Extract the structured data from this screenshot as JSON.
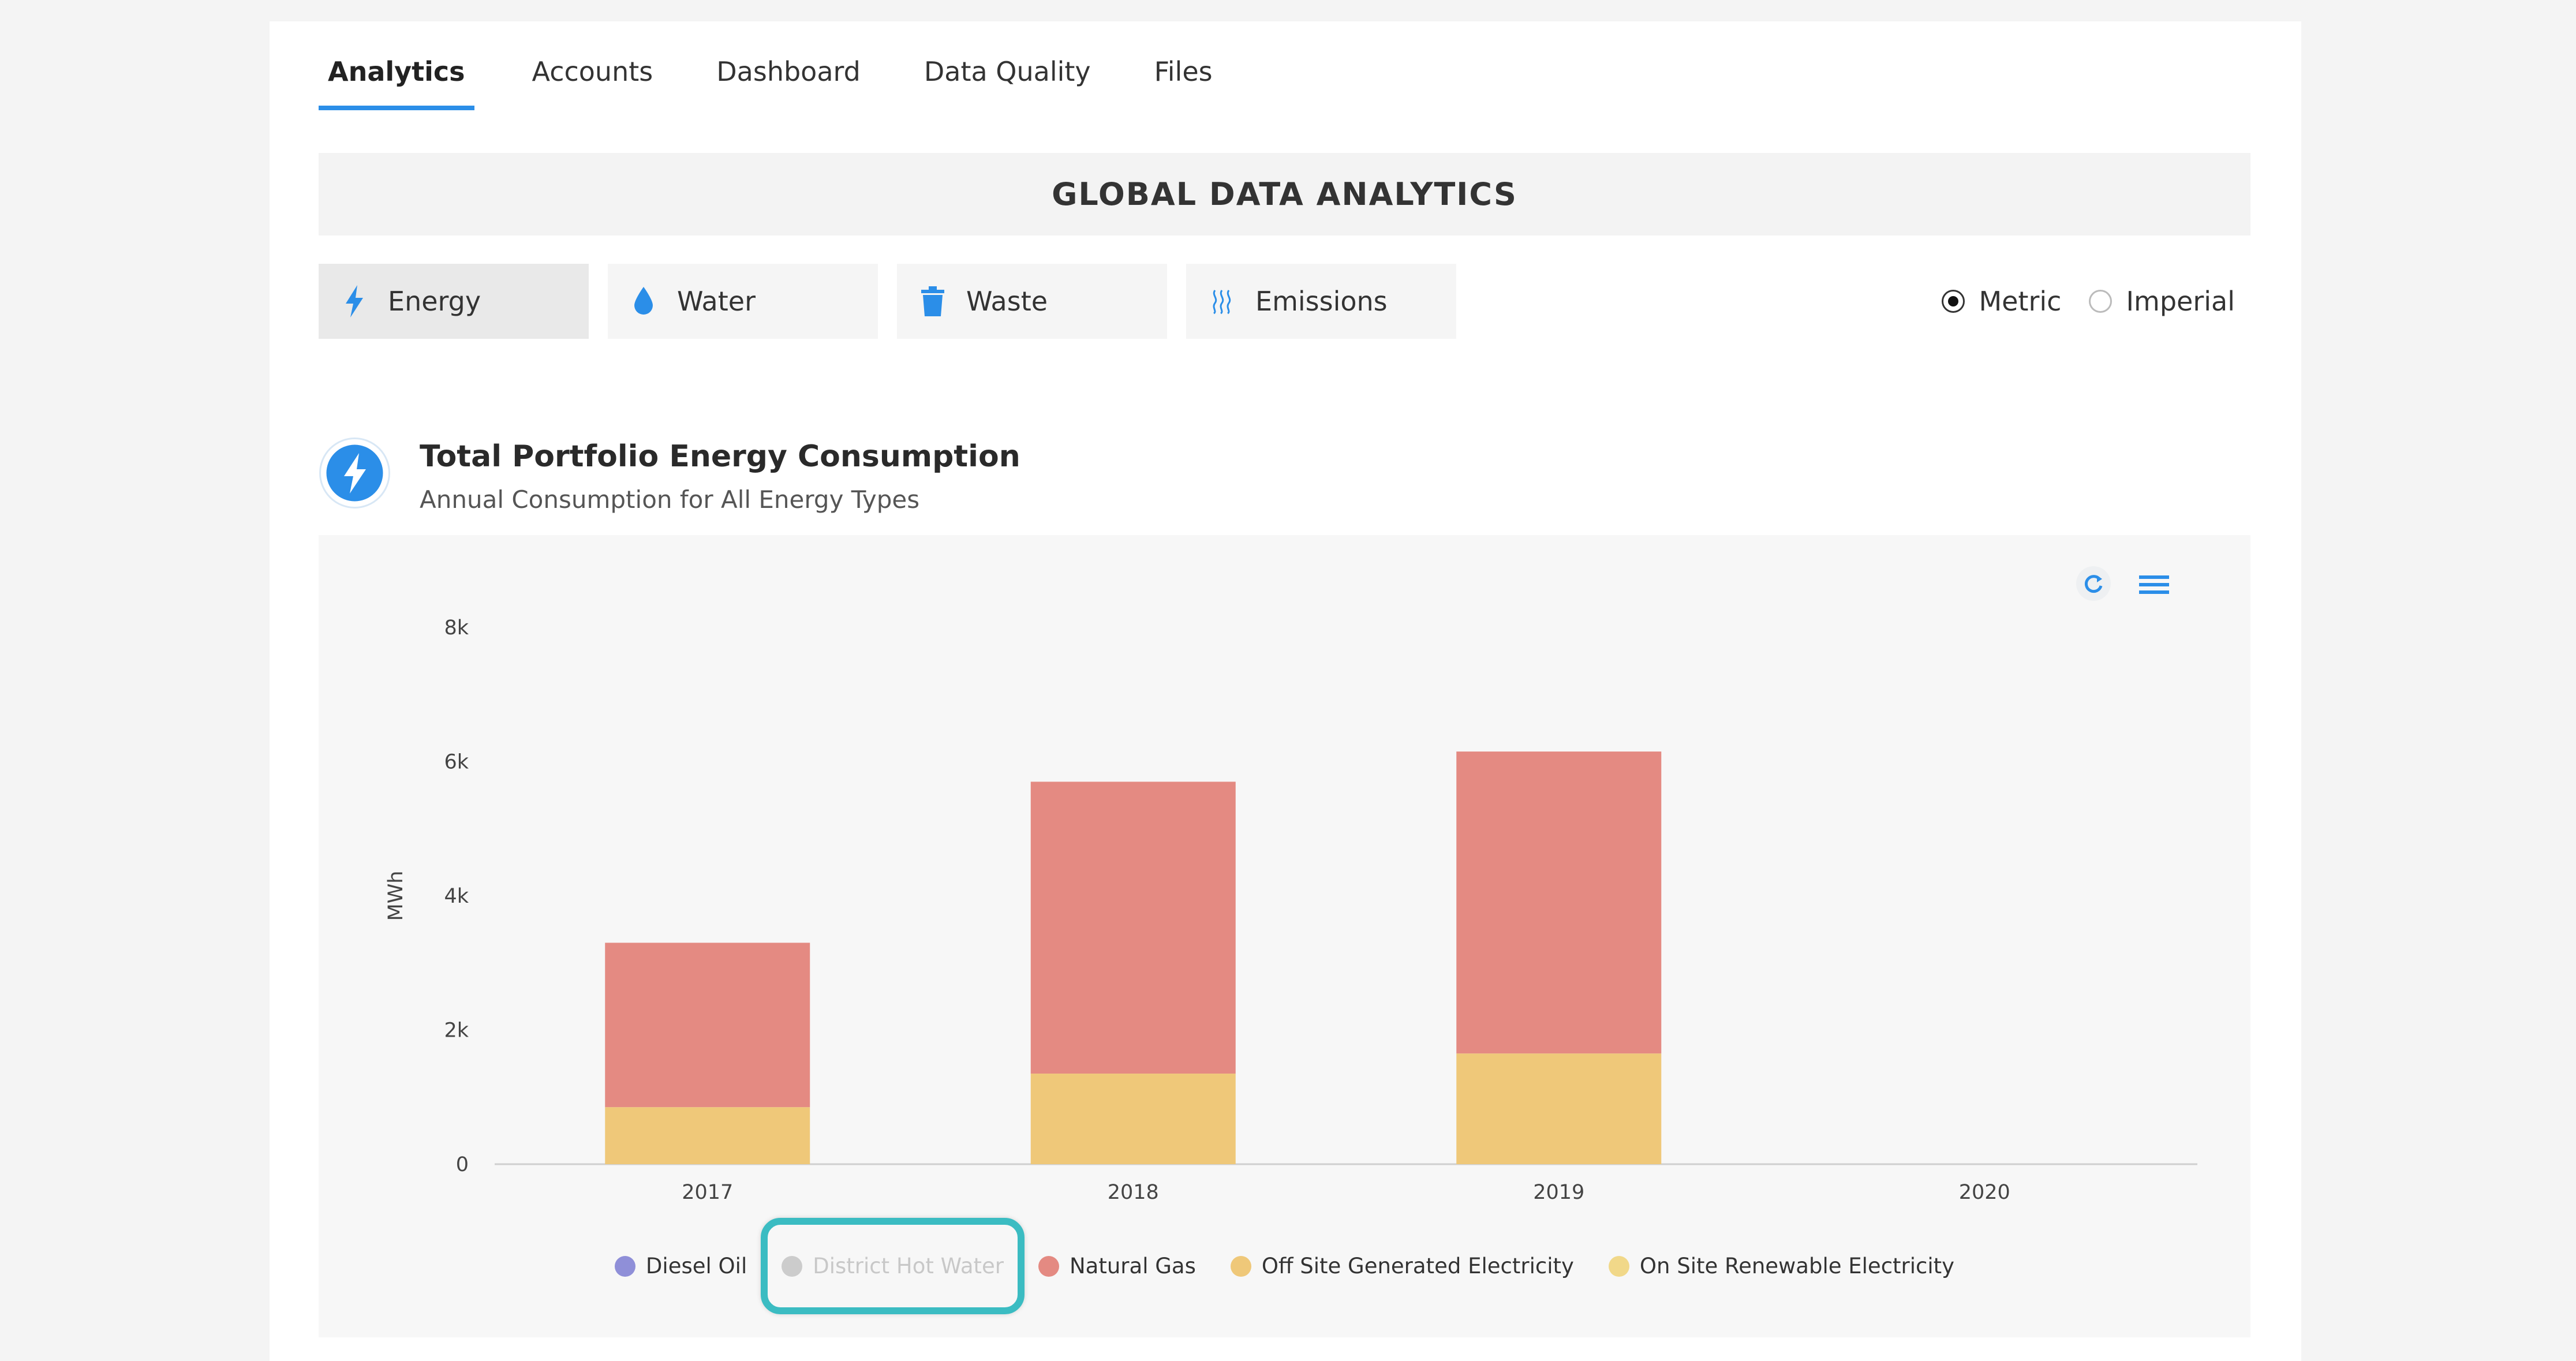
{
  "tabs": [
    {
      "label": "Analytics",
      "active": true
    },
    {
      "label": "Accounts"
    },
    {
      "label": "Dashboard"
    },
    {
      "label": "Data Quality"
    },
    {
      "label": "Files"
    }
  ],
  "banner_title": "GLOBAL DATA ANALYTICS",
  "categories": [
    {
      "label": "Energy",
      "icon": "lightning-icon",
      "active": true
    },
    {
      "label": "Water",
      "icon": "water-drop-icon"
    },
    {
      "label": "Waste",
      "icon": "trash-icon"
    },
    {
      "label": "Emissions",
      "icon": "heat-waves-icon"
    }
  ],
  "units": {
    "metric": "Metric",
    "imperial": "Imperial",
    "selected": "Metric"
  },
  "chart_header": {
    "title": "Total Portfolio Energy Consumption",
    "subtitle": "Annual Consumption for All Energy Types",
    "icon": "lightning-circle-icon"
  },
  "toolbar": {
    "refresh_icon": "refresh-icon",
    "menu_icon": "hamburger-menu-icon"
  },
  "colors": {
    "accent": "#2b8ee8",
    "diesel_oil": "#8f8fd8",
    "district_hot_water": "#cccccc",
    "natural_gas": "#e48a82",
    "off_site_electricity": "#efc879",
    "on_site_renewable": "#f1d889",
    "highlight": "#3bbcc2"
  },
  "chart_data": {
    "type": "bar",
    "stacked": true,
    "categories": [
      "2017",
      "2018",
      "2019",
      "2020"
    ],
    "ylabel": "MWh",
    "ylim": [
      0,
      8000
    ],
    "yticks": [
      {
        "value": 0,
        "label": "0"
      },
      {
        "value": 2000,
        "label": "2k"
      },
      {
        "value": 4000,
        "label": "4k"
      },
      {
        "value": 6000,
        "label": "6k"
      },
      {
        "value": 8000,
        "label": "8k"
      }
    ],
    "series": [
      {
        "name": "Diesel Oil",
        "color": "#8f8fd8",
        "values": [
          0,
          0,
          0,
          0
        ]
      },
      {
        "name": "District Hot Water",
        "color": "#cccccc",
        "values": [
          0,
          0,
          0,
          0
        ],
        "hidden": true
      },
      {
        "name": "Natural Gas",
        "color": "#e48a82",
        "values": [
          2450,
          4350,
          4500,
          0
        ]
      },
      {
        "name": "Off Site Generated Electricity",
        "color": "#efc879",
        "values": [
          850,
          1350,
          1650,
          0
        ]
      },
      {
        "name": "On Site Renewable Electricity",
        "color": "#f1d889",
        "values": [
          0,
          0,
          0,
          0
        ]
      }
    ],
    "legend_position": "bottom",
    "grid": false
  },
  "legend": [
    {
      "label": "Diesel Oil",
      "color": "#8f8fd8",
      "disabled": false
    },
    {
      "label": "District Hot Water",
      "color": "#cccccc",
      "disabled": true,
      "highlighted": true
    },
    {
      "label": "Natural Gas",
      "color": "#e48a82",
      "disabled": false
    },
    {
      "label": "Off Site Generated Electricity",
      "color": "#efc879",
      "disabled": false
    },
    {
      "label": "On Site Renewable Electricity",
      "color": "#f1d889",
      "disabled": false
    }
  ]
}
